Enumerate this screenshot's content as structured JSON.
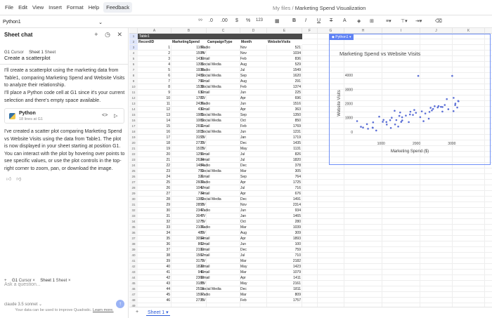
{
  "menu": [
    "File",
    "Edit",
    "View",
    "Insert",
    "Format",
    "Help"
  ],
  "feedback": "Feedback",
  "breadcrumb": {
    "folder": "My files",
    "sep": "/",
    "file": "Marketing Spend Visualization"
  },
  "namebox": "Python1",
  "toolbar": {
    "decimals_less": ".0",
    "decimals_more": ".00",
    "currency": "$",
    "percent": "%",
    "number": "123"
  },
  "chat": {
    "title": "Sheet chat",
    "ctx_cursor": "G1",
    "ctx_cursor_label": "Cursor",
    "ctx_sheet": "Sheet 1",
    "ctx_sheet_label": "Sheet",
    "user_message": "Create a scatterplot",
    "reply1": "I'll create a scatterplot using the marketing data from Table1, comparing Marketing Spend and Website Visits to analyze their relationship.",
    "reply2": "I'll place a Python code cell at G1 since it's your current selection and there's empty space available.",
    "code_title": "Python",
    "code_sub": "18 lines at G1",
    "reply3": "I've created a scatter plot comparing Marketing Spend vs Website Visits using the data from Table1. The plot is now displayed in your sheet starting at position G1. You can interact with the plot by hovering over points to see specific values, or use the plot controls in the top-right corner to zoom, pan, or download the image.",
    "ask_placeholder": "Ask a question...",
    "model": "claude 3.5 sonnet",
    "footer": "Your data can be used to improve Quadratic.",
    "footer_link": "Learn more."
  },
  "grid": {
    "columns": [
      "A",
      "B",
      "C",
      "D",
      "E",
      "F",
      "G",
      "H",
      "I",
      "J",
      "K",
      "L"
    ],
    "table_name": "Table1",
    "headers": [
      "RecordID",
      "MarketingSpend",
      "CampaignType",
      "Month",
      "WebsiteVisits"
    ],
    "rows": [
      [
        1,
        1160,
        "Radio",
        "Nov",
        521
      ],
      [
        2,
        1594,
        "TV",
        "Nov",
        1034
      ],
      [
        3,
        1430,
        "Email",
        "Feb",
        836
      ],
      [
        4,
        1395,
        "Social Media",
        "Aug",
        529
      ],
      [
        5,
        1938,
        "Radio",
        "Jul",
        1549
      ],
      [
        6,
        2469,
        "Social Media",
        "Sep",
        1620
      ],
      [
        7,
        766,
        "Email",
        "Aug",
        291
      ],
      [
        8,
        1538,
        "Social Media",
        "Feb",
        1374
      ],
      [
        9,
        630,
        "Email",
        "Jun",
        225
      ],
      [
        10,
        1782,
        "TV",
        "Apr",
        696
      ],
      [
        11,
        2435,
        "Radio",
        "Jun",
        1516
      ],
      [
        12,
        430,
        "Email",
        "Apr",
        363
      ],
      [
        13,
        1985,
        "Social Media",
        "Sep",
        1350
      ],
      [
        14,
        1069,
        "Social Media",
        "Oct",
        850
      ],
      [
        15,
        2691,
        "Email",
        "Feb",
        1769
      ],
      [
        16,
        1815,
        "Social Media",
        "Jun",
        1231
      ],
      [
        17,
        3153,
        "TV",
        "Jan",
        1719
      ],
      [
        18,
        2733,
        "TV",
        "Dec",
        1435
      ],
      [
        19,
        1515,
        "TV",
        "May",
        1131
      ],
      [
        20,
        1255,
        "Email",
        "Jul",
        826
      ],
      [
        21,
        2624,
        "Email",
        "Jul",
        1820
      ],
      [
        22,
        1484,
        "Radio",
        "Dec",
        378
      ],
      [
        23,
        759,
        "Social Media",
        "Mar",
        305
      ],
      [
        24,
        321,
        "Email",
        "Sep",
        764
      ],
      [
        25,
        2600,
        "Radio",
        "Apr",
        1725
      ],
      [
        26,
        1047,
        "Email",
        "Jul",
        716
      ],
      [
        27,
        774,
        "Email",
        "Apr",
        676
      ],
      [
        28,
        1382,
        "Social Media",
        "Dec",
        1491
      ],
      [
        29,
        2858,
        "TV",
        "Nov",
        2314
      ],
      [
        30,
        2347,
        "Radio",
        "Jun",
        934
      ],
      [
        31,
        3047,
        "TV",
        "Jan",
        1465
      ],
      [
        32,
        1275,
        "TV",
        "Oct",
        280
      ],
      [
        33,
        2106,
        "Radio",
        "Mar",
        1039
      ],
      [
        34,
        489,
        "TV",
        "Aug",
        309
      ],
      [
        35,
        3094,
        "Email",
        "Apr",
        1893
      ],
      [
        36,
        862,
        "Email",
        "Jun",
        100
      ],
      [
        37,
        2199,
        "Email",
        "Dec",
        759
      ],
      [
        38,
        1567,
        "Email",
        "Jul",
        710
      ],
      [
        39,
        3179,
        "TV",
        "Mar",
        2182
      ],
      [
        40,
        1828,
        "Email",
        "May",
        1423
      ],
      [
        41,
        946,
        "Email",
        "Mar",
        1079
      ],
      [
        42,
        2368,
        "Email",
        "Apr",
        1411
      ],
      [
        43,
        3188,
        "TV",
        "May",
        2161
      ],
      [
        44,
        2514,
        "Social Media",
        "Dec",
        1811
      ],
      [
        45,
        1597,
        "Radio",
        "Mar",
        809
      ],
      [
        46,
        2735,
        "TV",
        "Feb",
        1757
      ]
    ]
  },
  "chart_tag": "Python1",
  "chart_data": {
    "type": "scatter",
    "title": "Marketing Spend vs Website Visits",
    "xlabel": "Marketing Spend ($)",
    "ylabel": "Website Visits",
    "xticks": [
      1000,
      2000,
      3000
    ],
    "yticks": [
      0,
      1000,
      2000,
      3000,
      4000
    ],
    "xlim": [
      300,
      3400
    ],
    "ylim": [
      -300,
      4300
    ],
    "color": "#5b6fd6",
    "points": [
      [
        1160,
        521
      ],
      [
        1594,
        1034
      ],
      [
        1430,
        836
      ],
      [
        1395,
        529
      ],
      [
        1938,
        1549
      ],
      [
        2469,
        1620
      ],
      [
        766,
        291
      ],
      [
        1538,
        1374
      ],
      [
        630,
        225
      ],
      [
        1782,
        696
      ],
      [
        2435,
        1516
      ],
      [
        430,
        363
      ],
      [
        1985,
        1350
      ],
      [
        1069,
        850
      ],
      [
        2691,
        1769
      ],
      [
        1815,
        1231
      ],
      [
        3153,
        1719
      ],
      [
        2733,
        1435
      ],
      [
        1515,
        1131
      ],
      [
        1255,
        826
      ],
      [
        2624,
        1820
      ],
      [
        1484,
        378
      ],
      [
        759,
        305
      ],
      [
        321,
        764
      ],
      [
        2600,
        1725
      ],
      [
        1047,
        716
      ],
      [
        774,
        676
      ],
      [
        1382,
        1491
      ],
      [
        2858,
        2314
      ],
      [
        2347,
        934
      ],
      [
        3047,
        1465
      ],
      [
        1275,
        280
      ],
      [
        2106,
        1039
      ],
      [
        489,
        309
      ],
      [
        3094,
        1893
      ],
      [
        862,
        100
      ],
      [
        2199,
        759
      ],
      [
        1567,
        710
      ],
      [
        3179,
        2182
      ],
      [
        1828,
        1423
      ],
      [
        946,
        1079
      ],
      [
        2368,
        1411
      ],
      [
        3188,
        2161
      ],
      [
        2514,
        1811
      ],
      [
        1597,
        809
      ],
      [
        2735,
        1757
      ],
      [
        2050,
        3950
      ],
      [
        3010,
        3950
      ],
      [
        1700,
        1150
      ],
      [
        2250,
        1300
      ],
      [
        2900,
        1600
      ],
      [
        1300,
        1000
      ],
      [
        2400,
        1700
      ],
      [
        3050,
        2400
      ],
      [
        3100,
        2000
      ],
      [
        1150,
        700
      ],
      [
        2800,
        1900
      ],
      [
        1900,
        1200
      ],
      [
        600,
        550
      ],
      [
        2150,
        1450
      ]
    ]
  },
  "sheet_tab": "Sheet 1"
}
